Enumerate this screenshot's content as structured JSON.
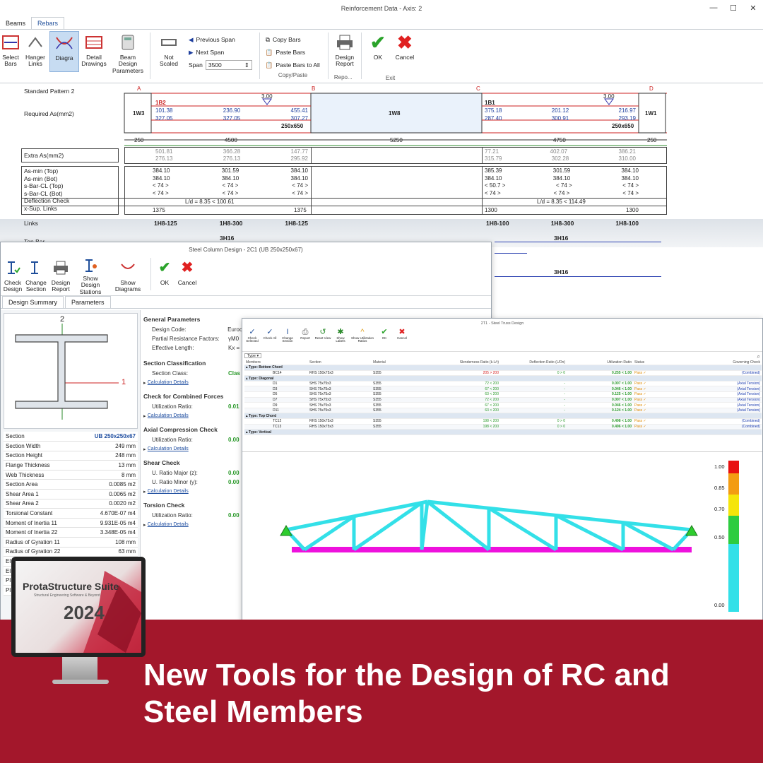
{
  "w1": {
    "title": "Reinforcement Data - Axis: 2",
    "tabs": [
      "Beams",
      "Rebars"
    ],
    "ribbon": {
      "select": "Select Bars",
      "hanger": "Hanger Links",
      "diagrams": "Diagra",
      "detail": "Detail Drawings",
      "beam_params": "Beam Design Parameters",
      "not_scaled": "Not Scaled",
      "prev_span": "Previous Span",
      "next_span": "Next Span",
      "span_label": "Span",
      "span_value": "3500",
      "copy": "Copy Bars",
      "paste": "Paste Bars",
      "paste_all": "Paste Bars to All",
      "copy_grp": "Copy/Paste",
      "design_report": "Design Report",
      "report_grp": "Repo...",
      "ok": "OK",
      "cancel": "Cancel",
      "exit_grp": "Exit"
    },
    "pattern": "Standard Pattern 2",
    "req_label": "Required As(mm2)",
    "axes": [
      "A",
      "B",
      "C",
      "D"
    ],
    "walls": [
      "1W3",
      "1W8",
      "1W1"
    ],
    "b1": {
      "name": "1B2",
      "top": [
        "101.38",
        "236.90",
        "455.41"
      ],
      "bot": [
        "327.05",
        "327.05",
        "307.27"
      ],
      "sec": "250x650"
    },
    "b2": {
      "name": "1B1",
      "top": [
        "375.18",
        "201.12",
        "216.97"
      ],
      "bot": [
        "287.40",
        "300.91",
        "293.19"
      ],
      "sec": "250x650"
    },
    "marker": "3.00",
    "dims": [
      "250",
      "4500",
      "5250",
      "4750",
      "250"
    ],
    "extra_label": "Extra As(mm2)",
    "extra1": [
      [
        "501.81",
        "366.28",
        "147.77"
      ],
      [
        "276.13",
        "276.13",
        "295.92"
      ]
    ],
    "extra2": [
      [
        "77.21",
        "402.07",
        "386.21"
      ],
      [
        "315.79",
        "302.28",
        "310.00"
      ]
    ],
    "row_labels": [
      "As-min (Top)",
      "As-min (Bot)",
      "s-Bar-CL (Top)",
      "s-Bar-CL (Bot)",
      "Deflection Check",
      "x-Sup. Links"
    ],
    "rows1": [
      [
        "384.10",
        "301.59",
        "384.10"
      ],
      [
        "384.10",
        "384.10",
        "384.10"
      ],
      [
        "< 74 >",
        "< 74 >",
        "< 74 >"
      ],
      [
        "< 74 >",
        "< 74 >",
        "< 74 >"
      ]
    ],
    "rows2": [
      [
        "385.39",
        "301.59",
        "384.10"
      ],
      [
        "384.10",
        "384.10",
        "384.10"
      ],
      [
        "< 50.7 >",
        "< 74 >",
        "< 74 >"
      ],
      [
        "< 74 >",
        "< 74 >",
        "< 74 >"
      ]
    ],
    "defl1": "L/d = 8.35 < 100.61",
    "defl2": "L/d = 8.35 < 114.49",
    "xsup1": [
      "1375",
      "1375"
    ],
    "xsup2": [
      "1300",
      "1300"
    ],
    "links_label": "Links",
    "links1": [
      "1H8-125",
      "1H8-300",
      "1H8-125"
    ],
    "links2": [
      "1H8-100",
      "1H8-300",
      "1H8-100"
    ],
    "top_bar_label": "Top Bar",
    "bar1": "3H16",
    "bar2": "3H16",
    "bar3": "3H16"
  },
  "w2": {
    "title": "Steel Column Design - 2C1 (UB 250x250x67)",
    "ribbon": [
      "Check Design",
      "Change Section",
      "Design Report",
      "Show Design Stations",
      "Show Diagrams",
      "OK",
      "Cancel"
    ],
    "tabs": [
      "Design Summary",
      "Parameters"
    ],
    "axis_major": "2",
    "axis_minor": "1",
    "props": [
      [
        "Section",
        "UB 250x250x67"
      ],
      [
        "Section Width",
        "249 mm"
      ],
      [
        "Section Height",
        "248 mm"
      ],
      [
        "Flange Thickness",
        "13 mm"
      ],
      [
        "Web Thickness",
        "8 mm"
      ],
      [
        "Section Area",
        "0.0085 m2"
      ],
      [
        "Shear Area 1",
        "0.0065 m2"
      ],
      [
        "Shear Area 2",
        "0.0020 m2"
      ],
      [
        "Torsional Constant",
        "4.670E-07 m4"
      ],
      [
        "Moment of Inertia 11",
        "9.931E-05 m4"
      ],
      [
        "Moment of Inertia 22",
        "3.348E-05 m4"
      ],
      [
        "Radius of Gyration 11",
        "108 mm"
      ],
      [
        "Radius of Gyration 22",
        "63 mm"
      ],
      [
        "El",
        ""
      ],
      [
        "El",
        ""
      ],
      [
        "Pl",
        ""
      ],
      [
        "Pl",
        ""
      ]
    ],
    "general": {
      "head": "General Parameters",
      "code_l": "Design Code:",
      "code_v": "Euroc",
      "prf_l": "Partial Resistance Factors:",
      "prf_v": "γM0",
      "eff_l": "Effective Length:",
      "eff_v": "Kx ="
    },
    "classif": {
      "head": "Section Classification",
      "l": "Section Class:",
      "v": "Clas"
    },
    "combined": {
      "head": "Check for Combined Forces",
      "l": "Utilization Ratio:",
      "v": "0.01"
    },
    "axial": {
      "head": "Axial Compression Check",
      "l": "Utilization Ratio:",
      "v": "0.00"
    },
    "shear": {
      "head": "Shear Check",
      "l1": "U. Ratio Major (z):",
      "v1": "0.00",
      "l2": "U. Ratio Minor (y):",
      "v2": "0.00"
    },
    "torsion": {
      "head": "Torsion Check",
      "l": "Utilization Ratio:",
      "v": "0.00"
    },
    "calc": "Calculation Details"
  },
  "w3": {
    "title": "2T1 - Steel Truss Design",
    "ribbon": [
      "Check Selected",
      "Check All",
      "Change Section",
      "Report",
      "Reset View",
      "Show Labels",
      "Show Utilization Ratios",
      "OK",
      "Cancel"
    ],
    "filter": "Type",
    "headers": [
      "Members",
      "Section",
      "Material",
      "Slenderness Ratio (k.L/r)",
      "Deflection Ratio (L/Dn)",
      "Utilization Ratio",
      "Status",
      "Governing Check"
    ],
    "groups": [
      {
        "name": "Type: Bottom Chord",
        "rows": [
          [
            "BC14",
            "RHS 150x75x3",
            "S355",
            "205 > 200",
            "0 > 0",
            "0.255 < 1.00",
            "Pass",
            "(Combined)"
          ]
        ]
      },
      {
        "name": "Type: Diagonal",
        "rows": [
          [
            "D1",
            "SHS 75x75x3",
            "S355",
            "72 < 200",
            "-",
            "0.007 < 1.00",
            "Pass",
            "(Axial Tension)"
          ],
          [
            "D3",
            "SHS 75x75x3",
            "S355",
            "67 < 200",
            "-",
            "0.046 < 1.00",
            "Pass",
            "(Axial Tension)"
          ],
          [
            "D5",
            "SHS 75x75x3",
            "S355",
            "63 < 200",
            "-",
            "0.125 < 1.00",
            "Pass",
            "(Axial Tension)"
          ],
          [
            "D7",
            "SHS 75x75x3",
            "S355",
            "72 < 200",
            "-",
            "0.007 < 1.00",
            "Pass",
            "(Axial Tension)"
          ],
          [
            "D9",
            "SHS 75x75x3",
            "S355",
            "67 < 200",
            "-",
            "0.046 < 1.00",
            "Pass",
            "(Axial Tension)"
          ],
          [
            "D11",
            "SHS 75x75x3",
            "S355",
            "63 < 200",
            "-",
            "0.124 < 1.00",
            "Pass",
            "(Axial Tension)"
          ]
        ]
      },
      {
        "name": "Type: Top Chord",
        "rows": [
          [
            "TC12",
            "RHS 150x75x3",
            "S355",
            "198 < 200",
            "0 > 0",
            "0.498 < 1.00",
            "Pass",
            "(Combined)"
          ],
          [
            "TC13",
            "RHS 150x75x3",
            "S355",
            "198 < 200",
            "0 > 0",
            "0.496 < 1.00",
            "Pass",
            "(Combined)"
          ]
        ]
      },
      {
        "name": "Type: Vertical",
        "rows": []
      }
    ],
    "scale": [
      "1.00",
      "0.85",
      "0.70",
      "0.50",
      "0.00"
    ],
    "colors": {
      "truss": "#33e0e8",
      "bottom": "#ee11dd",
      "support": "#2ecc2e"
    }
  },
  "promo": {
    "brand": "ProtaStructure Suite",
    "tagline": "Structural Engineering Software & Beyond",
    "year": "2024",
    "headline": "New Tools for the Design of RC and Steel Members",
    "band_color": "#a3172b"
  }
}
